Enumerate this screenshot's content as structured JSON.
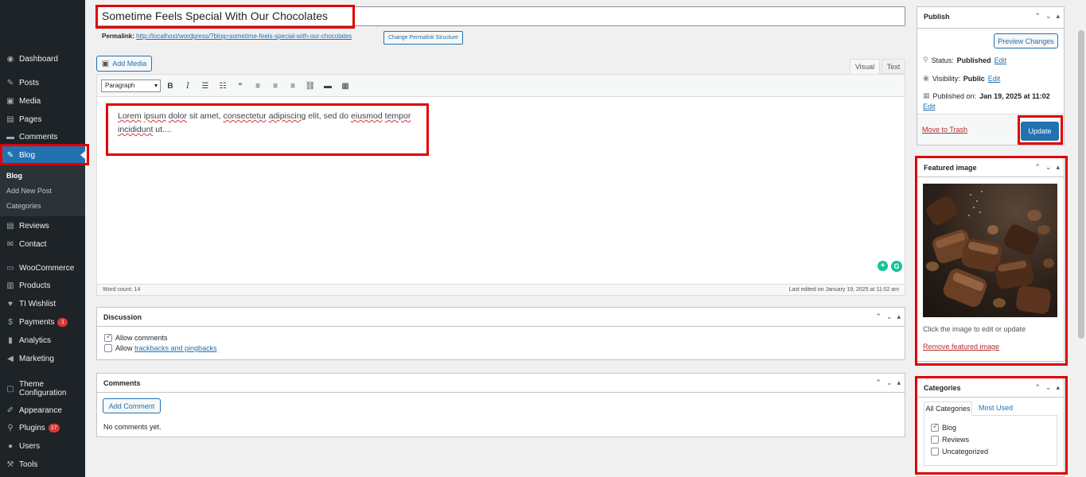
{
  "sidebar": {
    "items": [
      {
        "label": "Dashboard",
        "icon": "dashboard-icon",
        "glyph": "◉"
      },
      {
        "label": "Posts",
        "icon": "pin-icon",
        "glyph": "✎"
      },
      {
        "label": "Media",
        "icon": "media-icon",
        "glyph": "▣"
      },
      {
        "label": "Pages",
        "icon": "page-icon",
        "glyph": "▤"
      },
      {
        "label": "Comments",
        "icon": "comment-icon",
        "glyph": "▬"
      },
      {
        "label": "Blog",
        "icon": "edit-icon",
        "glyph": "✎"
      },
      {
        "label": "Reviews",
        "icon": "reviews-icon",
        "glyph": "▤"
      },
      {
        "label": "Contact",
        "icon": "mail-icon",
        "glyph": "✉"
      },
      {
        "label": "WooCommerce",
        "icon": "woo-icon",
        "glyph": "▭"
      },
      {
        "label": "Products",
        "icon": "products-icon",
        "glyph": "▥"
      },
      {
        "label": "TI Wishlist",
        "icon": "heart-icon",
        "glyph": "♥"
      },
      {
        "label": "Payments",
        "icon": "dollar-icon",
        "glyph": "$",
        "badge": "1"
      },
      {
        "label": "Analytics",
        "icon": "chart-icon",
        "glyph": "▮"
      },
      {
        "label": "Marketing",
        "icon": "megaphone-icon",
        "glyph": "◀"
      },
      {
        "label": "Theme Configuration",
        "icon": "theme-icon",
        "glyph": "▢"
      },
      {
        "label": "Appearance",
        "icon": "brush-icon",
        "glyph": "✐"
      },
      {
        "label": "Plugins",
        "icon": "plugin-icon",
        "glyph": "⚲",
        "badge": "17"
      },
      {
        "label": "Users",
        "icon": "user-icon",
        "glyph": "●"
      },
      {
        "label": "Tools",
        "icon": "wrench-icon",
        "glyph": "⚒"
      }
    ],
    "submenu": [
      "Blog",
      "Add New Post",
      "Categories"
    ]
  },
  "post": {
    "title": "Sometime Feels Special With Our Chocolates",
    "permalink_label": "Permalink:",
    "permalink_url": "http://localhost/wordpress/?blog=sometime-feels-special-with-our-chocolates",
    "change_permalink": "Change Permalink Structure",
    "add_media": "Add Media",
    "tab_visual": "Visual",
    "tab_text": "Text",
    "format": "Paragraph",
    "body_words": [
      "Lorem",
      " ",
      "ipsum",
      " ",
      "dolor",
      " sit amet, ",
      "consectetur",
      " ",
      "adipiscing",
      " elit, sed do ",
      "eiusmod",
      " ",
      "tempor"
    ],
    "body_line2_a": "incididunt",
    "body_line2_b": " ut....",
    "word_count": "Word count: 14",
    "last_edited": "Last edited on January 19, 2025 at 11:02 am"
  },
  "discussion": {
    "title": "Discussion",
    "allow_comments": "Allow comments",
    "allow_trackbacks_prefix": "Allow ",
    "allow_trackbacks_link": "trackbacks and pingbacks"
  },
  "comments": {
    "title": "Comments",
    "add_comment": "Add Comment",
    "empty": "No comments yet."
  },
  "publish": {
    "title": "Publish",
    "preview": "Preview Changes",
    "status_label": "Status:",
    "status_value": "Published",
    "visibility_label": "Visibility:",
    "visibility_value": "Public",
    "published_label": "Published on:",
    "published_value": "Jan 19, 2025 at 11:02",
    "edit": "Edit",
    "trash": "Move to Trash",
    "update": "Update"
  },
  "featured": {
    "title": "Featured image",
    "hint": "Click the image to edit or update",
    "remove": "Remove featured image"
  },
  "categories": {
    "title": "Categories",
    "tab_all": "All Categories",
    "tab_used": "Most Used",
    "items": [
      {
        "label": "Blog",
        "checked": true
      },
      {
        "label": "Reviews",
        "checked": false
      },
      {
        "label": "Uncategorized",
        "checked": false
      }
    ]
  },
  "colors": {
    "accent": "#2271b1",
    "highlight": "#e00000",
    "sidebar": "#1d2327"
  }
}
